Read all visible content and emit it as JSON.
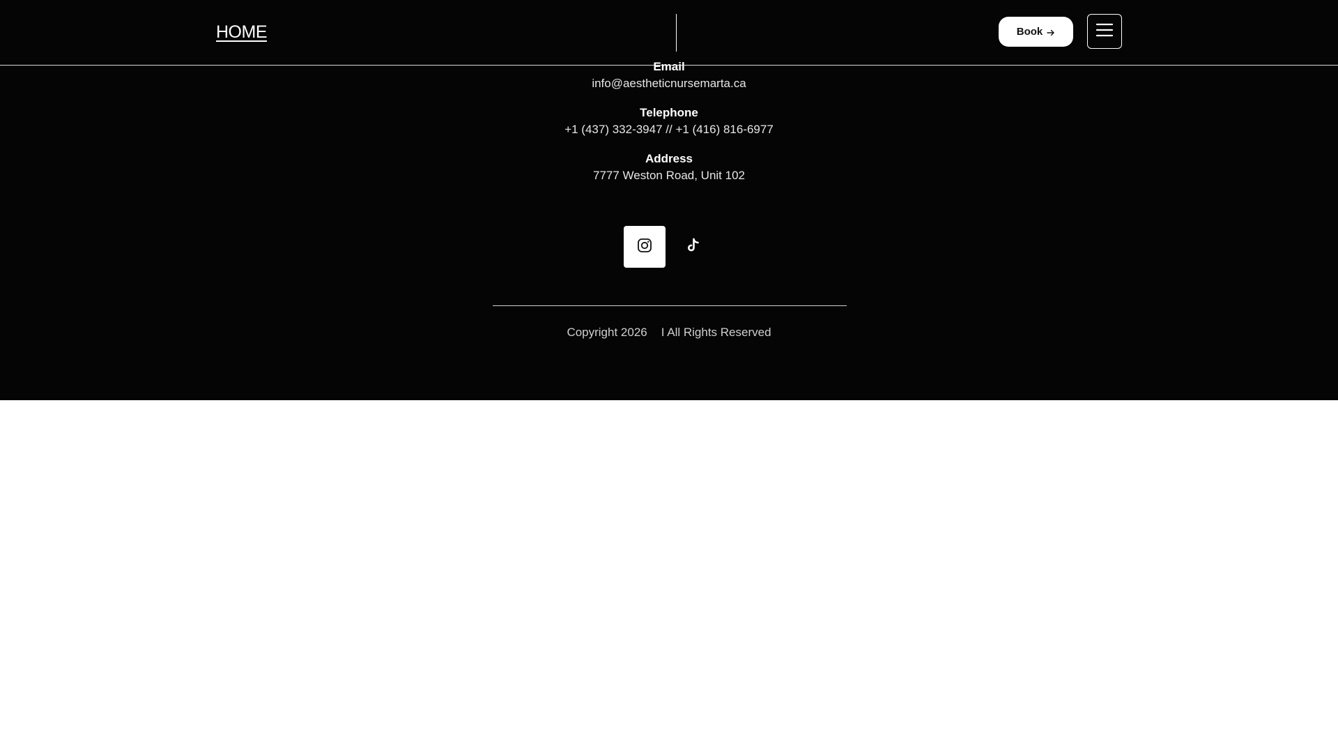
{
  "header": {
    "home_label": "HOME",
    "book_label": "Book",
    "book_icon": "arrow-right-icon",
    "menu_icon": "hamburger-menu-icon"
  },
  "contact": {
    "email_heading": "Email",
    "email_value": "info@aestheticnursemarta.ca",
    "phone_heading": "Telephone",
    "phone_value": "+1 (437) 332-3947 // +1 (416) 816-6977",
    "address_heading": "Address",
    "address_value": "7777 Weston Road, Unit 102"
  },
  "social": {
    "instagram_icon": "instagram-icon",
    "tiktok_icon": "tiktok-icon"
  },
  "footer": {
    "copyright": "Copyright 2026",
    "rights": "I All Rights Reserved"
  },
  "colors": {
    "footer_background": "#050505",
    "page_background": "#ffffff",
    "text": "#ffffff"
  }
}
